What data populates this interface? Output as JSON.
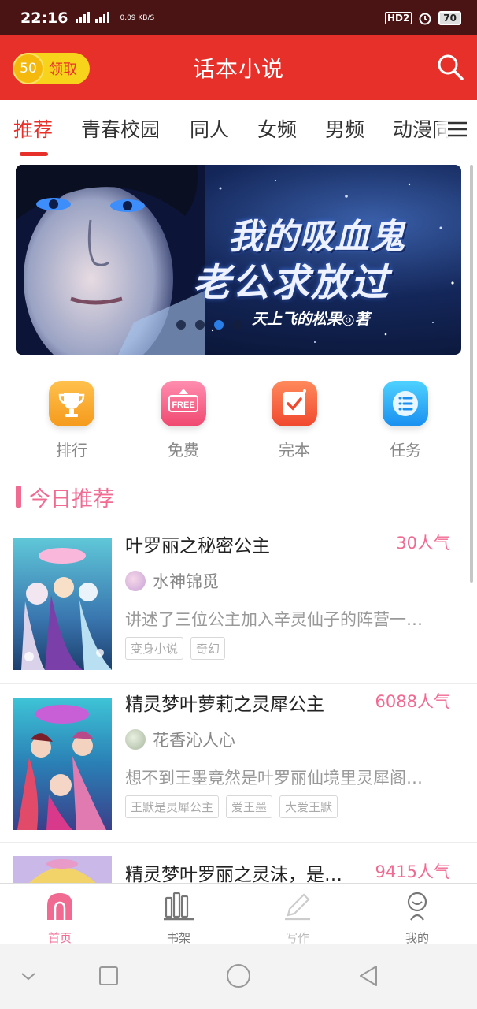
{
  "status_bar": {
    "time": "22:16",
    "network": "4G 4G",
    "speed": "0.09 KB/S",
    "battery": "70",
    "hd_badge": "HD2"
  },
  "header": {
    "title": "话本小说",
    "coin_amount": "50",
    "coin_label": "领取",
    "accent_color": "#e8302a"
  },
  "tabs": [
    {
      "label": "推荐",
      "active": true
    },
    {
      "label": "青春校园"
    },
    {
      "label": "同人"
    },
    {
      "label": "女频"
    },
    {
      "label": "男频"
    },
    {
      "label": "动漫同"
    }
  ],
  "banner": {
    "title_line1": "我的吸血鬼",
    "title_line2": "老公求放过",
    "author": "天上飞的松果◎著",
    "active_dot": 3,
    "dot_count": 4
  },
  "quick_links": [
    {
      "label": "排行",
      "icon": "trophy-icon"
    },
    {
      "label": "免费",
      "icon": "free-tag-icon",
      "icon_text": "FREE"
    },
    {
      "label": "完本",
      "icon": "completed-check-icon"
    },
    {
      "label": "任务",
      "icon": "task-list-icon"
    }
  ],
  "section": {
    "title": "今日推荐"
  },
  "books": [
    {
      "title": "叶罗丽之秘密公主",
      "popularity": "30人气",
      "author": "水神锦觅",
      "description": "讲述了三位公主加入辛灵仙子的阵营一…",
      "tags": [
        "变身小说",
        "奇幻"
      ]
    },
    {
      "title": "精灵梦叶萝莉之灵犀公主",
      "popularity": "6088人气",
      "author": "花香沁人心",
      "description": "想不到王墨竟然是叶罗丽仙境里灵犀阁…",
      "tags": [
        "王默是灵犀公主",
        "爱王墨",
        "大爱王默"
      ]
    },
    {
      "title": "精灵梦叶罗丽之灵沫，是…",
      "popularity": "9415人气"
    }
  ],
  "bottom_nav": [
    {
      "label": "首页",
      "icon": "home-icon",
      "active": true
    },
    {
      "label": "书架",
      "icon": "bookshelf-icon"
    },
    {
      "label": "写作",
      "icon": "pen-icon",
      "disabled": true
    },
    {
      "label": "我的",
      "icon": "profile-icon"
    }
  ],
  "colors": {
    "primary_red": "#e8302a",
    "pink": "#f06a92",
    "coin_yellow": "#f7d31c"
  }
}
